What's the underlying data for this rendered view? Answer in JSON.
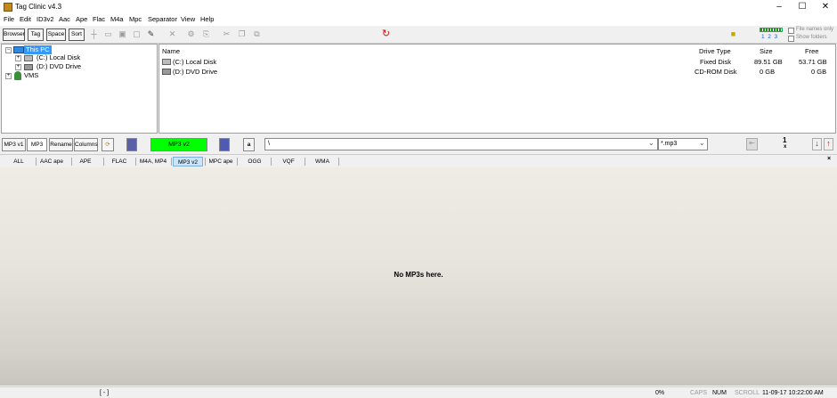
{
  "window": {
    "title": "Tag Clinic v4.3",
    "minimize": "–",
    "maximize": "☐",
    "close": "✕"
  },
  "menu": [
    "File",
    "Edit",
    "ID3v2",
    "Aac",
    "Ape",
    "Flac",
    "M4a",
    "Mpc",
    "Separator",
    "View",
    "Help"
  ],
  "toolbar": {
    "browser": "Browser",
    "tag": "Tag",
    "space": "Space",
    "sort": "Sort",
    "page_indicators": "1  2  3",
    "file_names_only": "File names only",
    "show_folders": "Show folders"
  },
  "tree": {
    "root": "This PC",
    "items": [
      "(C:) Local Disk",
      "(D:) DVD Drive",
      "VMS"
    ]
  },
  "filelist": {
    "columns": {
      "name": "Name",
      "type": "Drive Type",
      "size": "Size",
      "free": "Free"
    },
    "rows": [
      {
        "name": "(C:) Local Disk",
        "type": "Fixed Disk",
        "size": "89.51 GB",
        "free": "53.71 GB"
      },
      {
        "name": "(D:) DVD Drive",
        "type": "CD-ROM Disk",
        "size": "0 GB",
        "free": "0 GB"
      }
    ]
  },
  "tagbar": {
    "mp3v1": "MP3 v1",
    "mp3": "MP3",
    "rename": "Rename",
    "columns": "Columns",
    "mp3v2": "MP3 v2",
    "a_button": "a",
    "path": "\\",
    "mask": "*.mp3",
    "counter": "1",
    "counter_x": "x"
  },
  "filters": [
    "ALL",
    "AAC ape",
    "APE",
    "FLAC",
    "M4A, MP4",
    "MP3 v2",
    "MPC ape",
    "OGG",
    "VQF",
    "WMA"
  ],
  "filter_active": "MP3 v2",
  "content": {
    "message": "No MP3s here."
  },
  "status": {
    "selection": "[ - ]",
    "progress": "0%",
    "caps": "CAPS",
    "num": "NUM",
    "scroll": "SCROLL",
    "datetime": "11-09-17 10:22:00 AM"
  },
  "colors": {
    "mp3v2_button": "#00ff00",
    "tree_selected": "#3399ff",
    "active_filter": "#cce4f7"
  }
}
